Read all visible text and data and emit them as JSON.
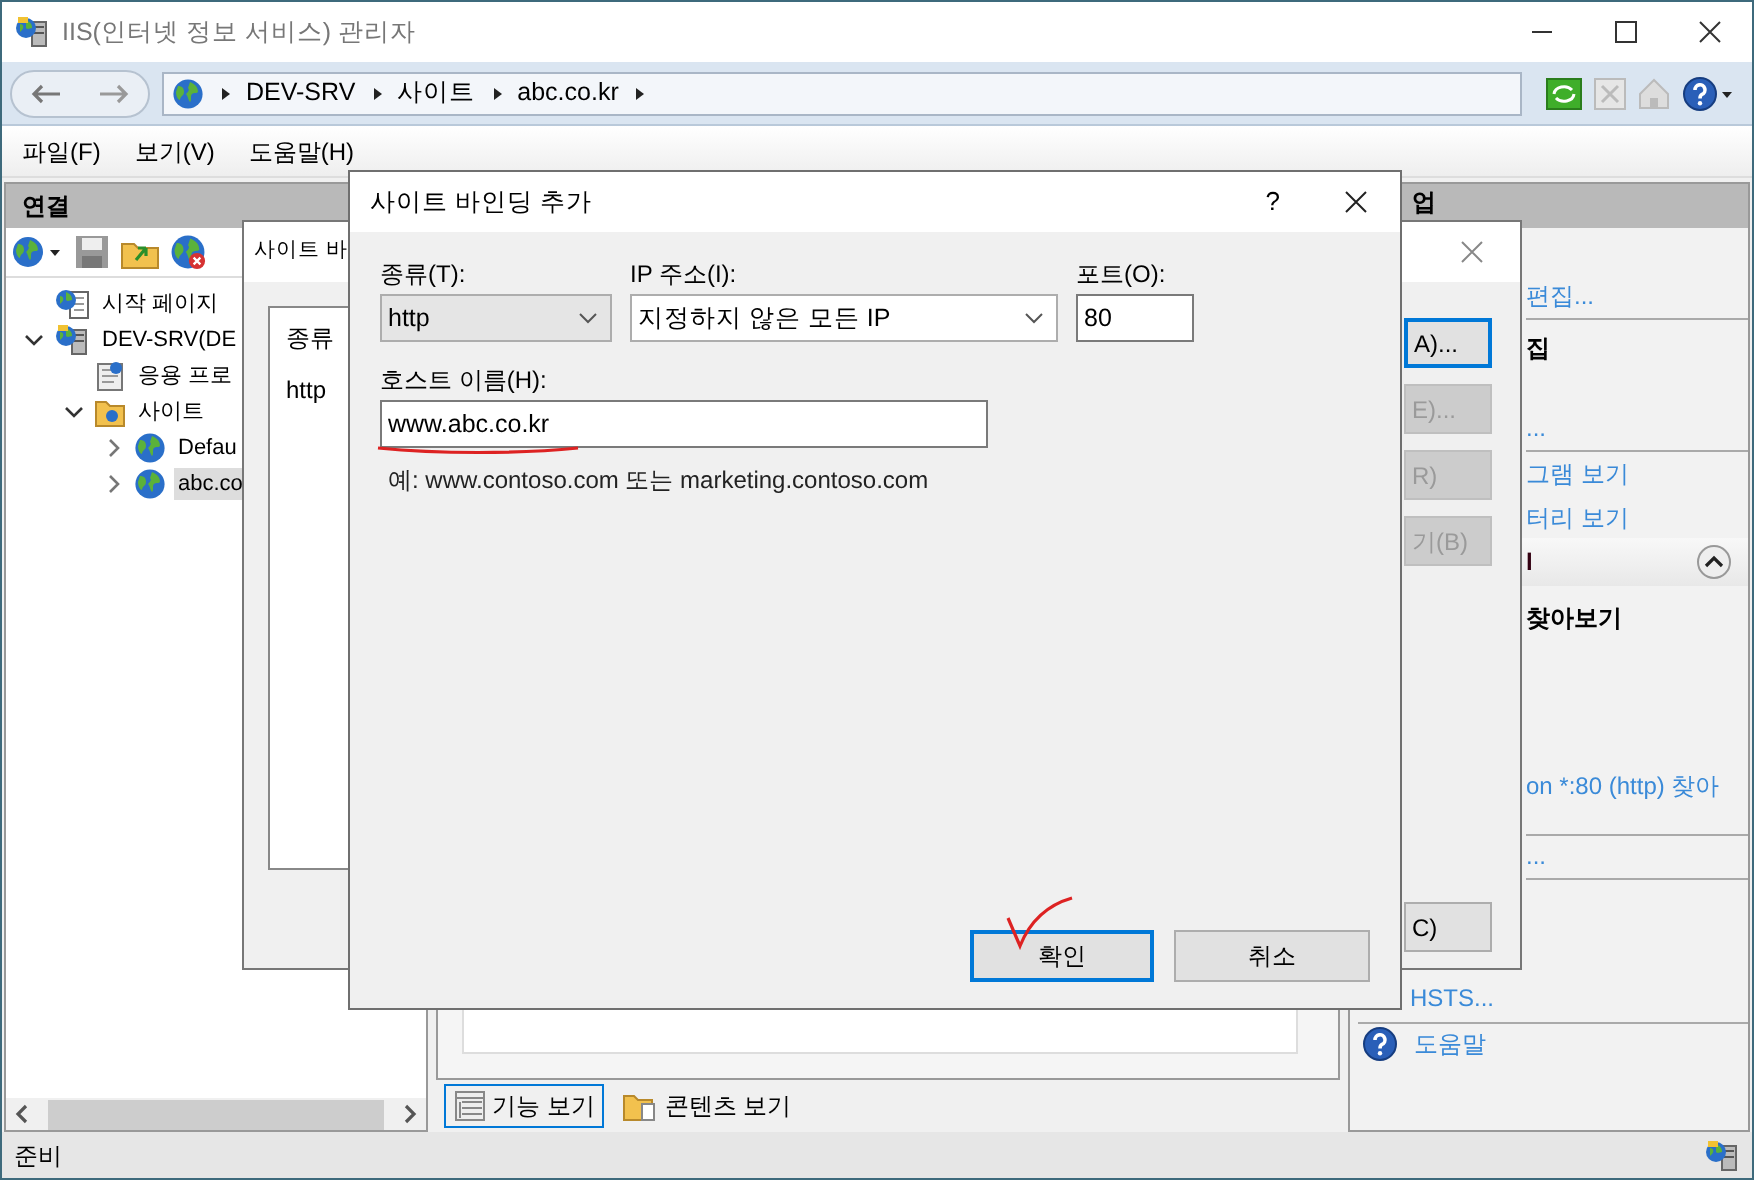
{
  "window": {
    "title": "IIS(인터넷 정보 서비스) 관리자"
  },
  "breadcrumb": [
    "DEV-SRV",
    "사이트",
    "abc.co.kr"
  ],
  "menu": [
    "파일(F)",
    "보기(V)",
    "도움말(H)"
  ],
  "connections": {
    "title": "연결",
    "tree": [
      {
        "label": "시작 페이지",
        "kind": "start"
      },
      {
        "label": "DEV-SRV(DE",
        "kind": "server",
        "expanded": true,
        "children": [
          {
            "label": "응용 프로",
            "kind": "pool"
          },
          {
            "label": "사이트",
            "kind": "sites",
            "expanded": true,
            "children": [
              {
                "label": "Defau",
                "kind": "site",
                "expanded": false,
                "selected": false
              },
              {
                "label": "abc.co",
                "kind": "site",
                "expanded": false,
                "selected": true
              }
            ]
          }
        ]
      }
    ]
  },
  "view_tabs": [
    {
      "label": "기능 보기",
      "selected": true,
      "kind": "features"
    },
    {
      "label": "콘텐츠 보기",
      "selected": false,
      "kind": "content"
    }
  ],
  "actions": {
    "title": "업",
    "items": [
      {
        "kind": "link",
        "text": "편집..."
      },
      {
        "kind": "heading",
        "text": "집"
      },
      {
        "kind": "link",
        "text": "..."
      },
      {
        "kind": "link",
        "text": "그램 보기"
      },
      {
        "kind": "link",
        "text": "터리 보기"
      },
      {
        "kind": "section",
        "text": "l"
      },
      {
        "kind": "heading",
        "text": "찾아보기"
      },
      {
        "kind": "link",
        "text": "on *:80 (http) 찾아"
      },
      {
        "kind": "link",
        "text": "..."
      },
      {
        "kind": "link",
        "text": "HSTS..."
      },
      {
        "kind": "help",
        "text": "도움말"
      }
    ]
  },
  "status_bar": "준비",
  "bindings_dialog": {
    "title": "사이트 바",
    "list": {
      "columns": [
        "종류"
      ],
      "rows": [
        "http"
      ]
    },
    "buttons": [
      {
        "label": "A)...",
        "disabled": false,
        "focused": true
      },
      {
        "label": "E)...",
        "disabled": true,
        "focused": false
      },
      {
        "label": "R)",
        "disabled": true,
        "focused": false
      },
      {
        "label": "기(B)",
        "disabled": true,
        "focused": false
      },
      {
        "label": "C)",
        "disabled": false,
        "focused": false
      }
    ]
  },
  "add_dialog": {
    "title": "사이트 바인딩 추가",
    "help": "?",
    "type": {
      "label": "종류(T):",
      "value": "http"
    },
    "ip": {
      "label": "IP 주소(I):",
      "value": "지정하지 않은 모든 IP"
    },
    "port": {
      "label": "포트(O):",
      "value": "80"
    },
    "host": {
      "label": "호스트 이름(H):",
      "value": "www.abc.co.kr"
    },
    "hint": "예: www.contoso.com 또는 marketing.contoso.com",
    "buttons": [
      {
        "label": "확인",
        "default": true
      },
      {
        "label": "취소",
        "default": false
      }
    ]
  }
}
